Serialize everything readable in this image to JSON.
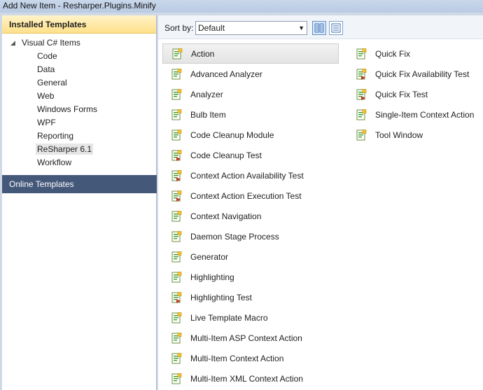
{
  "window": {
    "title": "Add New Item - Resharper.Plugins.Minify"
  },
  "left_pane": {
    "installed_header": "Installed Templates",
    "tree_root": "Visual C# Items",
    "tree_items": [
      "Code",
      "Data",
      "General",
      "Web",
      "Windows Forms",
      "WPF",
      "Reporting",
      "ReSharper 6.1",
      "Workflow"
    ],
    "selected_item": "ReSharper 6.1",
    "online_templates": "Online Templates"
  },
  "toolbar": {
    "sort_label": "Sort by:",
    "sort_value": "Default"
  },
  "templates_col1": [
    {
      "label": "Action",
      "icon": "code-file-icon",
      "selected": true
    },
    {
      "label": "Advanced Analyzer",
      "icon": "code-file-icon"
    },
    {
      "label": "Analyzer",
      "icon": "code-file-icon"
    },
    {
      "label": "Bulb Item",
      "icon": "code-file-icon"
    },
    {
      "label": "Code Cleanup Module",
      "icon": "code-file-icon"
    },
    {
      "label": "Code Cleanup Test",
      "icon": "test-file-icon"
    },
    {
      "label": "Context Action Availability Test",
      "icon": "test-file-icon"
    },
    {
      "label": "Context Action Execution Test",
      "icon": "test-file-icon"
    },
    {
      "label": "Context Navigation",
      "icon": "code-file-icon"
    },
    {
      "label": "Daemon Stage Process",
      "icon": "code-file-icon"
    },
    {
      "label": "Generator",
      "icon": "code-file-icon"
    },
    {
      "label": "Highlighting",
      "icon": "code-file-icon"
    },
    {
      "label": "Highlighting Test",
      "icon": "test-file-icon"
    },
    {
      "label": "Live Template Macro",
      "icon": "code-file-icon"
    },
    {
      "label": "Multi-Item ASP Context Action",
      "icon": "code-file-icon"
    },
    {
      "label": "Multi-Item Context Action",
      "icon": "code-file-icon"
    },
    {
      "label": "Multi-Item XML Context Action",
      "icon": "code-file-icon"
    }
  ],
  "templates_col2": [
    {
      "label": "Quick Fix",
      "icon": "code-file-icon"
    },
    {
      "label": "Quick Fix Availability Test",
      "icon": "test-file-icon"
    },
    {
      "label": "Quick Fix Test",
      "icon": "test-file-icon"
    },
    {
      "label": "Single-Item Context Action",
      "icon": "code-file-icon"
    },
    {
      "label": "Tool Window",
      "icon": "code-file-icon"
    }
  ],
  "colors": {
    "header_bg": "#ffe08a",
    "online_bg": "#44587a",
    "accent_green": "#3a9b2c",
    "test_red": "#c0392b"
  }
}
